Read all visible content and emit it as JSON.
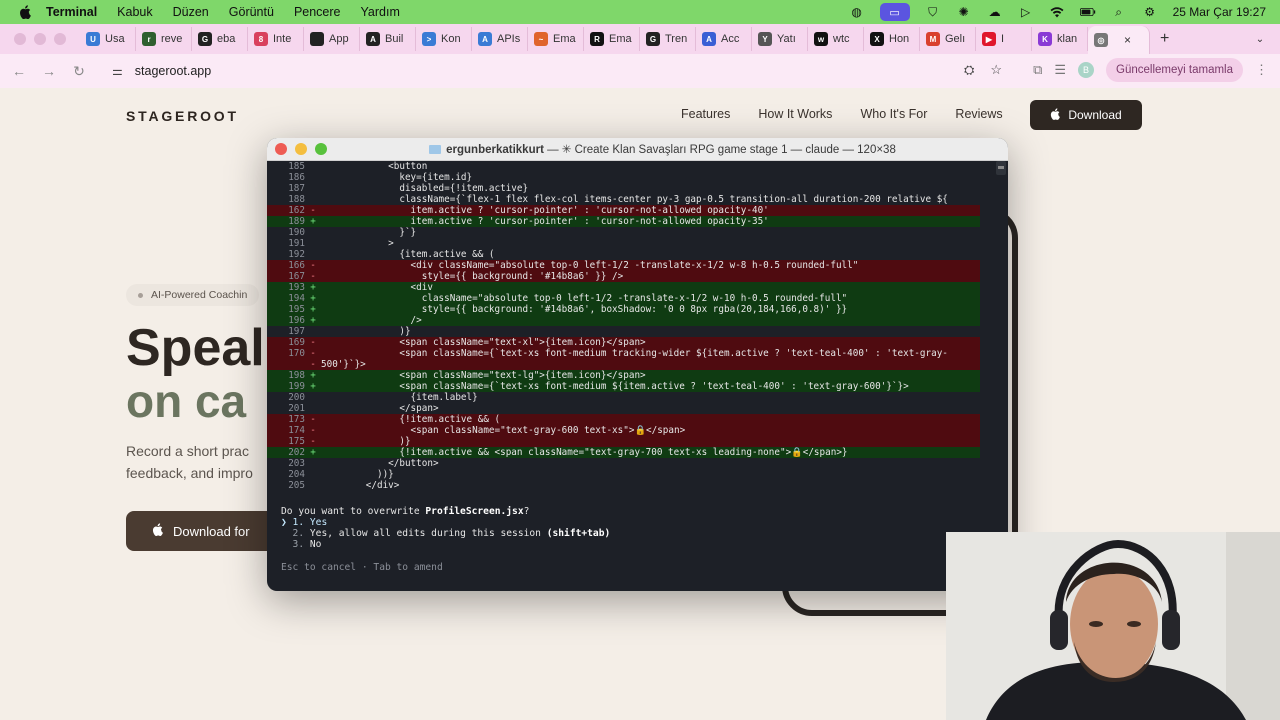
{
  "menubar": {
    "items": [
      "Terminal",
      "Kabuk",
      "Düzen",
      "Görüntü",
      "Pencere",
      "Yardım"
    ],
    "clock": "25 Mar Çar  19:27"
  },
  "tabs": [
    {
      "label": "Usa",
      "color": "#3a7bd5",
      "glyph": "U"
    },
    {
      "label": "reve",
      "color": "#2f5f2f",
      "glyph": "r"
    },
    {
      "label": "eba",
      "color": "#222222",
      "glyph": "G"
    },
    {
      "label": "Inte",
      "color": "#d9405e",
      "glyph": "8"
    },
    {
      "label": "App",
      "color": "#222222",
      "glyph": ""
    },
    {
      "label": "Buil",
      "color": "#222222",
      "glyph": "A"
    },
    {
      "label": "Kon",
      "color": "#3a7bd5",
      "glyph": ">"
    },
    {
      "label": "APIs",
      "color": "#3a7bd5",
      "glyph": "A"
    },
    {
      "label": "Ema",
      "color": "#e0642c",
      "glyph": "~"
    },
    {
      "label": "Ema",
      "color": "#111111",
      "glyph": "R"
    },
    {
      "label": "Tren",
      "color": "#222222",
      "glyph": "G"
    },
    {
      "label": "Acc",
      "color": "#3a5fd5",
      "glyph": "A"
    },
    {
      "label": "Yatı",
      "color": "#555555",
      "glyph": "Y"
    },
    {
      "label": "wtc",
      "color": "#111111",
      "glyph": "w"
    },
    {
      "label": "Hon",
      "color": "#111111",
      "glyph": "X"
    },
    {
      "label": "Gelı",
      "color": "#d9402e",
      "glyph": "M"
    },
    {
      "label": "I",
      "color": "#e0162c",
      "glyph": "▶"
    },
    {
      "label": "klan",
      "color": "#8a3ad5",
      "glyph": "K"
    },
    {
      "label": "",
      "color": "#777777",
      "glyph": "◎",
      "active": true
    }
  ],
  "address": {
    "url": "stageroot.app",
    "update_label": "Güncellemeyi tamamla",
    "avatar": "B"
  },
  "site": {
    "logo": "STAGEROOT",
    "nav": [
      "Features",
      "How It Works",
      "Who It's For",
      "Reviews"
    ],
    "download_label": "Download",
    "badge": "AI-Powered Coachin",
    "headline1": "Speal",
    "headline2": "on ca",
    "subtext": "Record a short prac feedback, and impro",
    "hero_button": "Download for"
  },
  "terminal": {
    "title_user": "ergunberkatikkurt",
    "title_rest": " — ✳ Create Klan Savaşları RPG game stage 1 — claude — 120×38",
    "lines": [
      {
        "n": "185",
        "t": "",
        "c": "            <button"
      },
      {
        "n": "186",
        "t": "",
        "c": "              key={item.id}"
      },
      {
        "n": "187",
        "t": "",
        "c": "              disabled={!item.active}"
      },
      {
        "n": "188",
        "t": "",
        "c": "              className={`flex-1 flex flex-col items-center py-3 gap-0.5 transition-all duration-200 relative ${"
      },
      {
        "n": "162",
        "t": "del",
        "c": "                item.active ? 'cursor-pointer' : 'cursor-not-allowed opacity-40'"
      },
      {
        "n": "189",
        "t": "add",
        "c": "                item.active ? 'cursor-pointer' : 'cursor-not-allowed opacity-35'"
      },
      {
        "n": "190",
        "t": "",
        "c": "              }`}"
      },
      {
        "n": "191",
        "t": "",
        "c": "            >"
      },
      {
        "n": "192",
        "t": "",
        "c": "              {item.active && ("
      },
      {
        "n": "166",
        "t": "del",
        "c": "                <div className=\"absolute top-0 left-1/2 -translate-x-1/2 w-8 h-0.5 rounded-full\""
      },
      {
        "n": "167",
        "t": "del",
        "c": "                  style={{ background: '#14b8a6' }} />"
      },
      {
        "n": "193",
        "t": "add",
        "c": "                <div"
      },
      {
        "n": "194",
        "t": "add",
        "c": "                  className=\"absolute top-0 left-1/2 -translate-x-1/2 w-10 h-0.5 rounded-full\""
      },
      {
        "n": "195",
        "t": "add",
        "c": "                  style={{ background: '#14b8a6', boxShadow: '0 0 8px rgba(20,184,166,0.8)' }}"
      },
      {
        "n": "196",
        "t": "add",
        "c": "                />"
      },
      {
        "n": "197",
        "t": "",
        "c": "              )}"
      },
      {
        "n": "169",
        "t": "del",
        "c": "              <span className=\"text-xl\">{item.icon}</span>"
      },
      {
        "n": "170",
        "t": "del",
        "c": "              <span className={`text-xs font-medium tracking-wider ${item.active ? 'text-teal-400' : 'text-gray-"
      },
      {
        "n": "",
        "t": "del",
        "c": "500'}`}>"
      },
      {
        "n": "198",
        "t": "add",
        "c": "              <span className=\"text-lg\">{item.icon}</span>"
      },
      {
        "n": "199",
        "t": "add",
        "c": "              <span className={`text-xs font-medium ${item.active ? 'text-teal-400' : 'text-gray-600'}`}>"
      },
      {
        "n": "200",
        "t": "",
        "c": "                {item.label}"
      },
      {
        "n": "201",
        "t": "",
        "c": "              </span>"
      },
      {
        "n": "173",
        "t": "del",
        "c": "              {!item.active && ("
      },
      {
        "n": "174",
        "t": "del",
        "c": "                <span className=\"text-gray-600 text-xs\">🔒</span>"
      },
      {
        "n": "175",
        "t": "del",
        "c": "              )}"
      },
      {
        "n": "202",
        "t": "add",
        "c": "              {!item.active && <span className=\"text-gray-700 text-xs leading-none\">🔒</span>}"
      },
      {
        "n": "203",
        "t": "",
        "c": "            </button>"
      },
      {
        "n": "204",
        "t": "",
        "c": "          ))}"
      },
      {
        "n": "205",
        "t": "",
        "c": "        </div>"
      }
    ],
    "question_prefix": "Do you want to overwrite ",
    "question_file": "ProfileScreen.jsx",
    "question_suffix": "?",
    "options": [
      {
        "marker": "❯ 1. ",
        "label": "Yes",
        "hint": ""
      },
      {
        "marker": "  2. ",
        "label": "Yes, allow all edits during this session ",
        "hint": "(shift+tab)"
      },
      {
        "marker": "  3. ",
        "label": "No",
        "hint": ""
      }
    ],
    "footer_hint": "Esc to cancel · Tab to amend"
  }
}
